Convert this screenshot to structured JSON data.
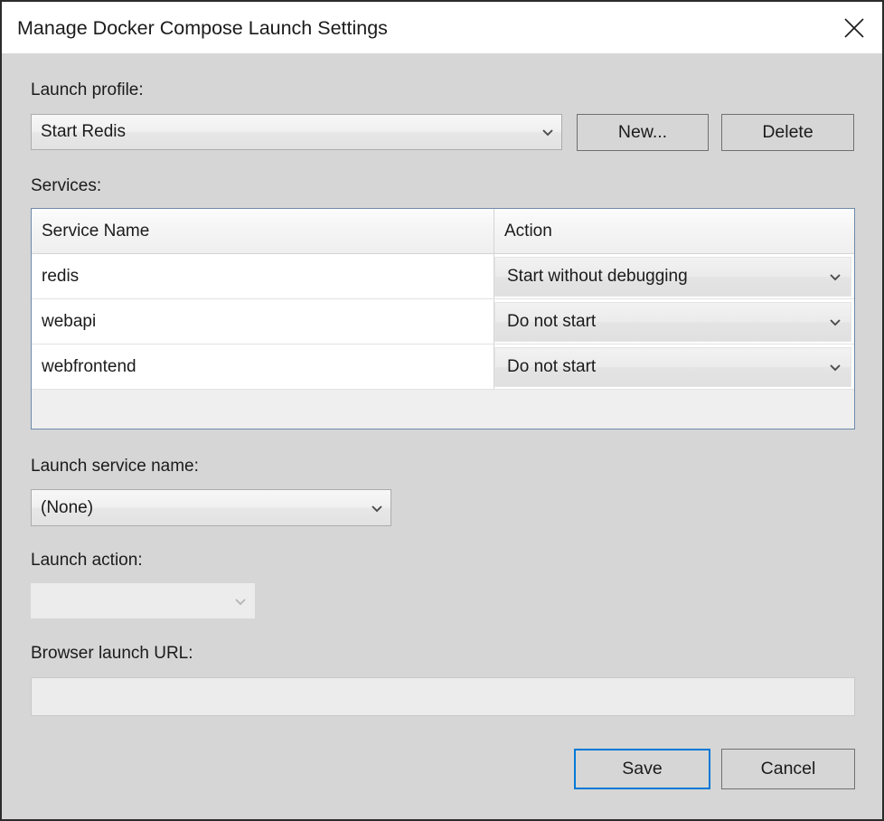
{
  "window": {
    "title": "Manage Docker Compose Launch Settings",
    "close_icon": "close-icon"
  },
  "launch_profile": {
    "label": "Launch profile:",
    "value": "Start Redis",
    "new_button": "New...",
    "delete_button": "Delete"
  },
  "services": {
    "label": "Services:",
    "columns": [
      "Service Name",
      "Action"
    ],
    "rows": [
      {
        "name": "redis",
        "action": "Start without debugging"
      },
      {
        "name": "webapi",
        "action": "Do not start"
      },
      {
        "name": "webfrontend",
        "action": "Do not start"
      }
    ]
  },
  "launch_service_name": {
    "label": "Launch service name:",
    "value": "(None)"
  },
  "launch_action": {
    "label": "Launch action:",
    "value": ""
  },
  "browser_launch_url": {
    "label": "Browser launch URL:",
    "value": ""
  },
  "footer": {
    "save_label": "Save",
    "cancel_label": "Cancel"
  },
  "colors": {
    "dialog_background": "#d6d6d6",
    "titlebar_background": "#ffffff",
    "accent_focus": "#0078d7",
    "grid_border": "#6d8aab",
    "text": "#1b1b1b"
  }
}
